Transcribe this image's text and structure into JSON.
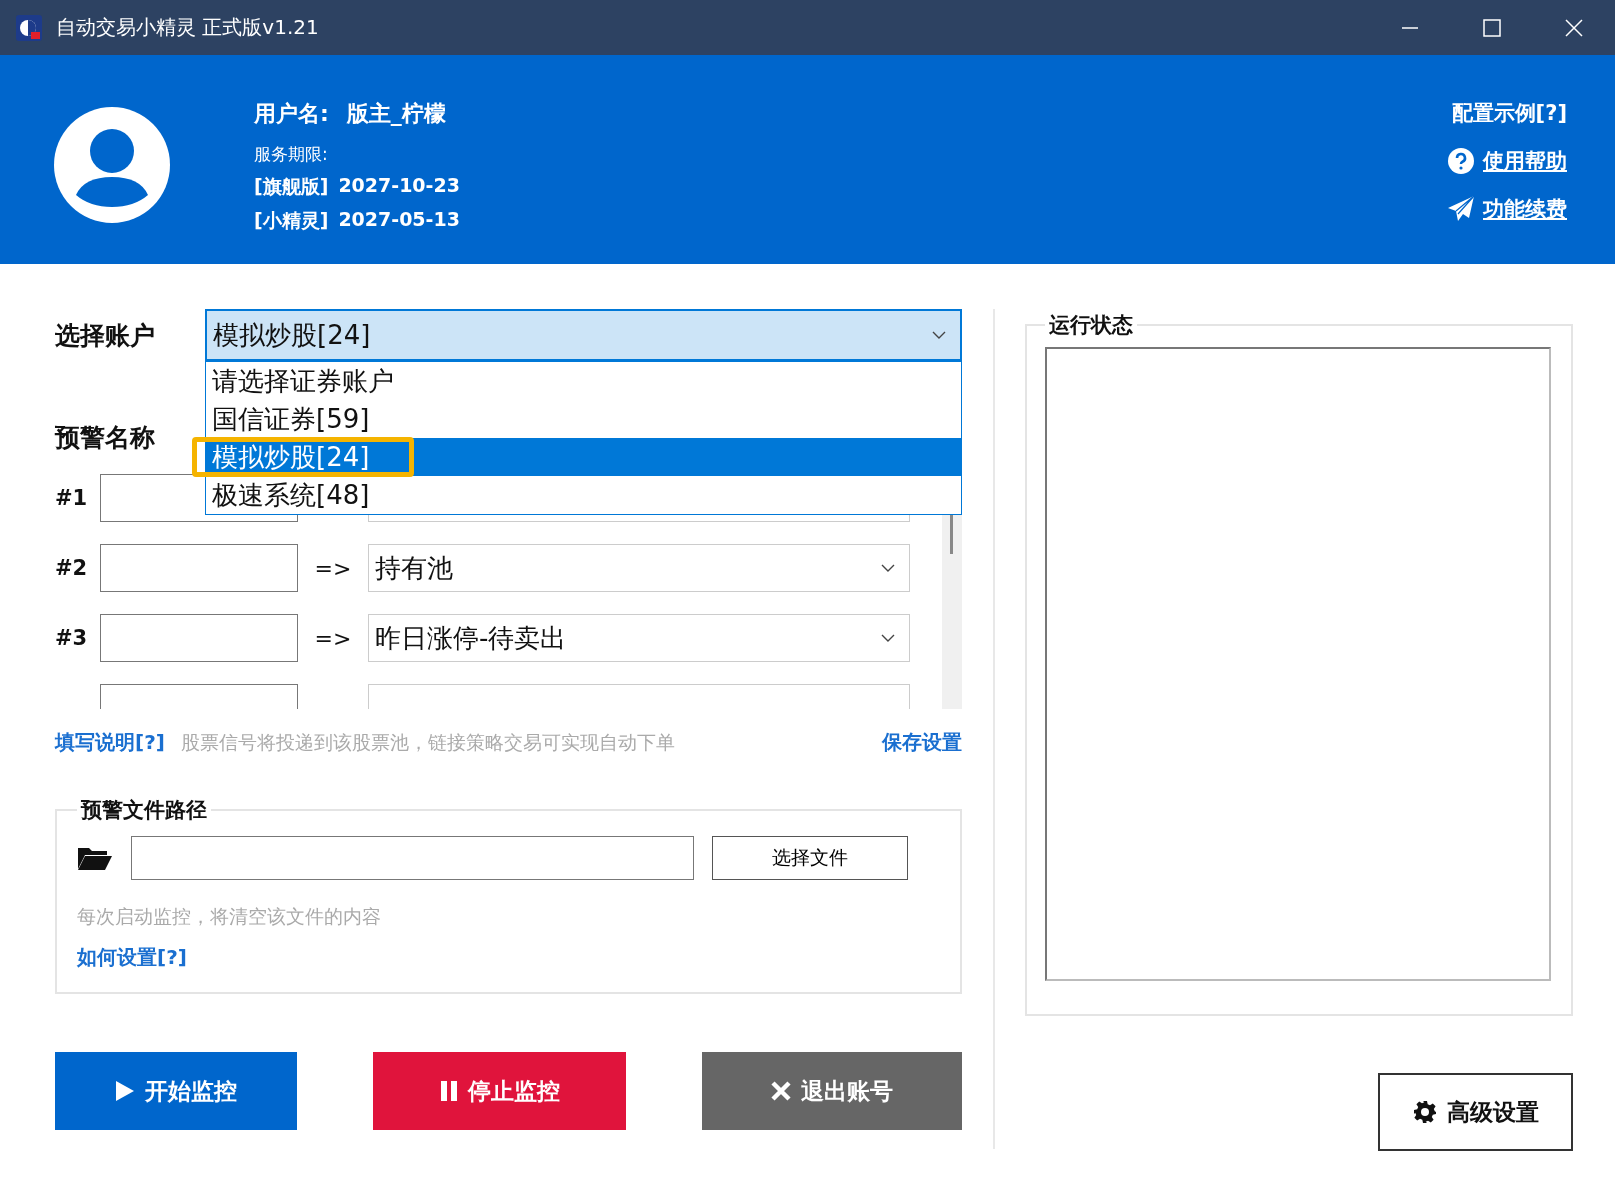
{
  "window": {
    "title": "自动交易小精灵 正式版v1.21"
  },
  "header": {
    "username_label": "用户名:",
    "username": "版主_柠檬",
    "service_label": "服务期限:",
    "licenses": [
      {
        "edition": "[旗舰版]",
        "date": "2027-10-23"
      },
      {
        "edition": "[小精灵]",
        "date": "2027-05-13"
      }
    ],
    "links": [
      {
        "kind": "plain",
        "label": "配置示例[?]"
      },
      {
        "kind": "help",
        "label": "使用帮助"
      },
      {
        "kind": "send",
        "label": "功能续费"
      }
    ]
  },
  "account": {
    "label": "选择账户",
    "value": "模拟炒股[24]",
    "expanded": true,
    "options": [
      {
        "label": "请选择证券账户",
        "selected": false,
        "highlighted": false
      },
      {
        "label": "国信证券[59]",
        "selected": false,
        "highlighted": false
      },
      {
        "label": "模拟炒股[24]",
        "selected": true,
        "highlighted": true
      },
      {
        "label": "极速系统[48]",
        "selected": false,
        "highlighted": false
      }
    ]
  },
  "alerts": {
    "label": "预警名称",
    "rows": [
      {
        "number": "#1"
      },
      {
        "number": "#2",
        "arrow": "=>",
        "pool": "持有池"
      },
      {
        "number": "#3",
        "arrow": "=>",
        "pool": "昨日涨停-待卖出"
      }
    ]
  },
  "hint": {
    "link": "填写说明[?]",
    "text": "股票信号将投递到该股票池，链接策略交易可实现自动下单",
    "save": "保存设置"
  },
  "file": {
    "title": "预警文件路径",
    "button": "选择文件",
    "note": "每次启动监控，将清空该文件的内容",
    "link": "如何设置[?]"
  },
  "status": {
    "title": "运行状态"
  },
  "buttons": [
    {
      "kind": "start",
      "label": "开始监控"
    },
    {
      "kind": "stop",
      "label": "停止监控"
    },
    {
      "kind": "logout",
      "label": "退出账号"
    },
    {
      "kind": "settings",
      "label": "高级设置"
    }
  ]
}
